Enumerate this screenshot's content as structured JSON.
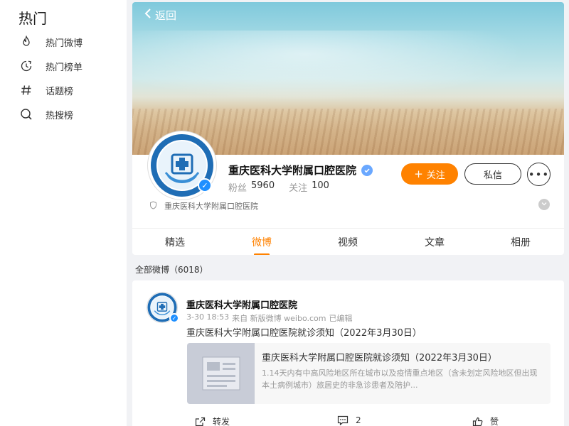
{
  "sidebar": {
    "title": "热门",
    "items": [
      {
        "label": "热门微博",
        "icon": "flame-icon"
      },
      {
        "label": "热门榜单",
        "icon": "clock-icon"
      },
      {
        "label": "话题榜",
        "icon": "hashtag-icon"
      },
      {
        "label": "热搜榜",
        "icon": "search-icon"
      }
    ]
  },
  "header": {
    "back_label": "返回"
  },
  "profile": {
    "name": "重庆医科大学附属口腔医院",
    "followers_label": "粉丝",
    "followers_value": "5960",
    "following_label": "关注",
    "following_value": "100",
    "follow_button": "关注",
    "message_button": "私信",
    "more_button": "•••",
    "description": "重庆医科大学附属口腔医院",
    "accent_color": "#ff8200"
  },
  "tabs": [
    {
      "label": "精选",
      "active": false
    },
    {
      "label": "微博",
      "active": true
    },
    {
      "label": "视频",
      "active": false
    },
    {
      "label": "文章",
      "active": false
    },
    {
      "label": "相册",
      "active": false
    }
  ],
  "feed": {
    "all_count_label": "全部微博（6018）"
  },
  "post": {
    "author": "重庆医科大学附属口腔医院",
    "time": "3-30 18:53",
    "source": "来自 新版微博 weibo.com",
    "edited": "已编辑",
    "text": "重庆医科大学附属口腔医院就诊须知（2022年3月30日）",
    "link": {
      "title": "重庆医科大学附属口腔医院就诊须知（2022年3月30日）",
      "desc": "1.14天内有中高风险地区所在城市以及疫情重点地区（含未划定风险地区但出现本土病例城市）旅居史的非急诊患者及陪护..."
    },
    "actions": {
      "repost": "转发",
      "comment_count": "2",
      "like": "赞"
    }
  }
}
